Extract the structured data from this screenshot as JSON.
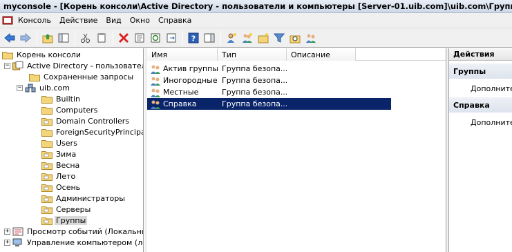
{
  "window": {
    "title": "myconsole - [Корень консоли\\Active Directory - пользователи и компьютеры [Server-01.uib.com]\\uib.com\\Группы]"
  },
  "menu": [
    "Консоль",
    "Действие",
    "Вид",
    "Окно",
    "Справка"
  ],
  "toolbar": {
    "icons": [
      "back-icon",
      "forward-icon",
      "up-folder-icon",
      "show-hide-tree-icon",
      "cut-icon",
      "copy-icon",
      "delete-icon",
      "properties-icon",
      "refresh-icon",
      "export-icon",
      "help-icon",
      "show-hide-action-pane-icon",
      "new-user-icon",
      "new-group-icon",
      "new-ou-icon",
      "filter-icon",
      "find-icon",
      "add-to-group-icon"
    ]
  },
  "tree": {
    "root": "Корень консоли",
    "ad": "Active Directory - пользователи и",
    "saved_queries": "Сохраненные запросы",
    "domain": "uib.com",
    "containers": [
      "Builtin",
      "Computers",
      "Domain Controllers",
      "ForeignSecurityPrincipals",
      "Users",
      "Зима",
      "Весна",
      "Лето",
      "Осень",
      "Администраторы",
      "Серверы",
      "Группы"
    ],
    "event_viewer": "Просмотр событий (Локальный)",
    "computer_mgmt": "Управление компьютером (локал"
  },
  "list": {
    "columns": [
      "Имя",
      "Тип",
      "Описание"
    ],
    "rows": [
      {
        "name": "Актив группы",
        "type": "Группа безопа...",
        "desc": ""
      },
      {
        "name": "Иногородные",
        "type": "Группа безопа...",
        "desc": ""
      },
      {
        "name": "Местные",
        "type": "Группа безопа...",
        "desc": ""
      },
      {
        "name": "Справка",
        "type": "Группа безопа...",
        "desc": ""
      }
    ],
    "selected_index": 3
  },
  "actions": {
    "header": "Действия",
    "sections": [
      {
        "title": "Группы",
        "item": "Дополнител"
      },
      {
        "title": "Справка",
        "item": "Дополнител"
      }
    ]
  },
  "colors": {
    "selection": "#0a246a",
    "folder": "#f5d57a"
  }
}
